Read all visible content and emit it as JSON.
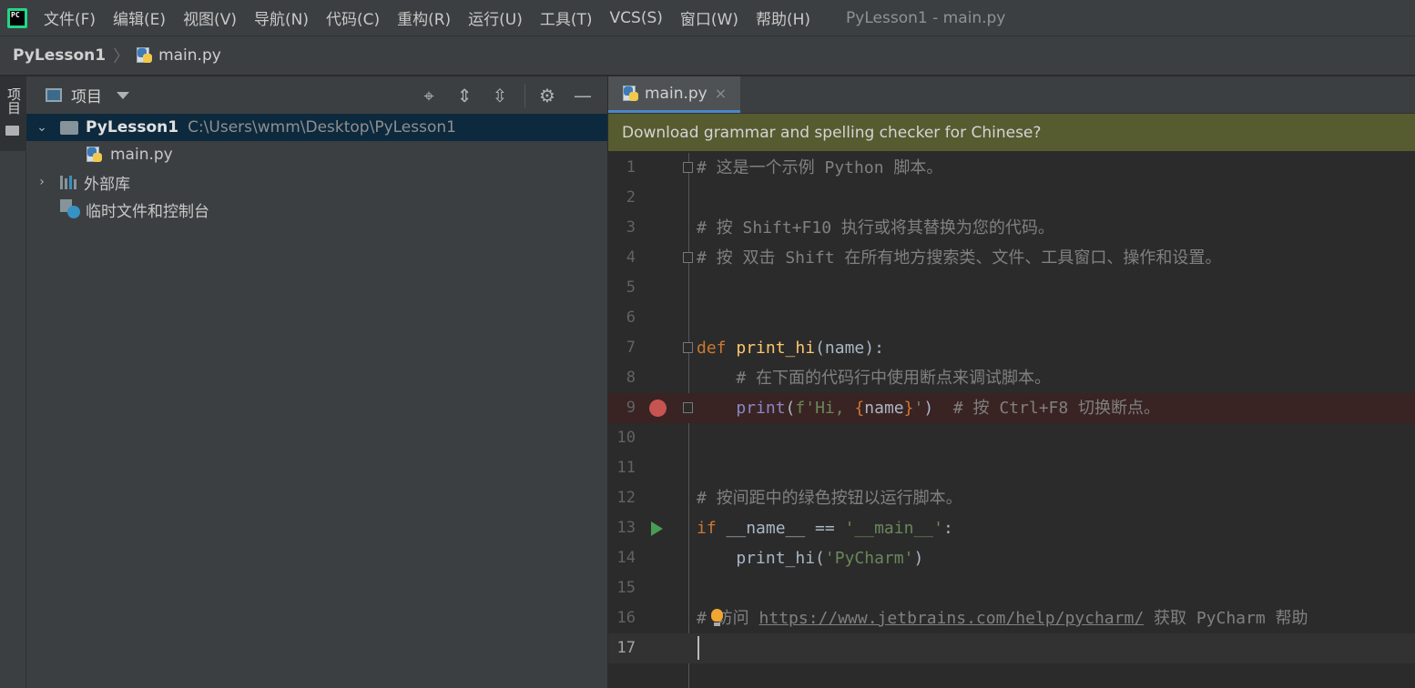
{
  "menubar": {
    "logo_text": "PC",
    "items": [
      "文件(F)",
      "编辑(E)",
      "视图(V)",
      "导航(N)",
      "代码(C)",
      "重构(R)",
      "运行(U)",
      "工具(T)",
      "VCS(S)",
      "窗口(W)",
      "帮助(H)"
    ],
    "window_title": "PyLesson1 - main.py"
  },
  "navbar": {
    "project": "PyLesson1",
    "file": "main.py"
  },
  "leftstrip": {
    "tab_label": "项目"
  },
  "project_panel": {
    "title": "项目",
    "tree": {
      "root_name": "PyLesson1",
      "root_path": "C:\\Users\\wmm\\Desktop\\PyLesson1",
      "file": "main.py",
      "external_libs": "外部库",
      "scratches": "临时文件和控制台"
    }
  },
  "editor": {
    "tab": {
      "label": "main.py",
      "close": "×"
    },
    "notification": "Download grammar and spelling checker for Chinese?",
    "line_numbers": [
      "1",
      "2",
      "3",
      "4",
      "5",
      "6",
      "7",
      "8",
      "9",
      "10",
      "11",
      "12",
      "13",
      "14",
      "15",
      "16",
      "17"
    ],
    "code": {
      "l1": "# 这是一个示例 Python 脚本。",
      "l3": "# 按 Shift+F10 执行或将其替换为您的代码。",
      "l4": "# 按 双击 Shift 在所有地方搜索类、文件、工具窗口、操作和设置。",
      "l7_kw": "def",
      "l7_fn": "print_hi",
      "l7_rest": "(name):",
      "l8": "    # 在下面的代码行中使用断点来调试脚本。",
      "l9_indent": "    ",
      "l9_fn": "print",
      "l9_p1": "(",
      "l9_str1": "f'Hi, ",
      "l9_brace1": "{",
      "l9_name": "name",
      "l9_brace2": "}",
      "l9_str2": "'",
      "l9_p2": ")",
      "l9_cmt": "  # 按 Ctrl+F8 切换断点。",
      "l12": "# 按间距中的绿色按钮以运行脚本。",
      "l13_kw": "if",
      "l13_mid": " __name__ == ",
      "l13_str": "'__main__'",
      "l13_end": ":",
      "l14_pre": "    print_hi(",
      "l14_str": "'PyCharm'",
      "l14_end": ")",
      "l16_pre": "# 访问 ",
      "l16_link": "https://www.jetbrains.com/help/pycharm/",
      "l16_post": " 获取 PyCharm 帮助"
    }
  }
}
